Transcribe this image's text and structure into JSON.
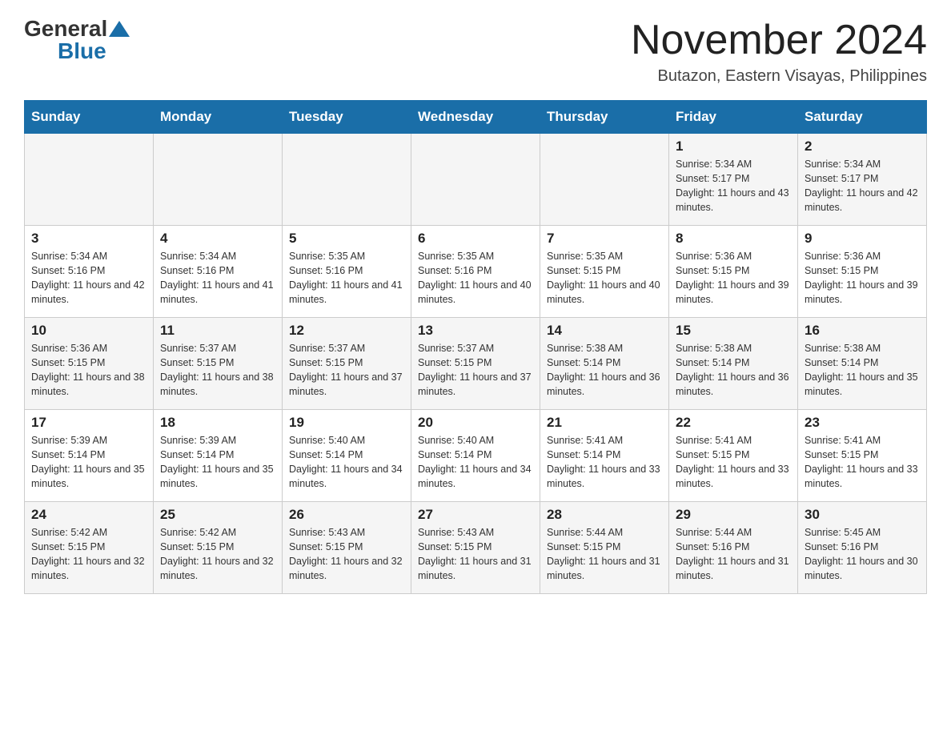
{
  "header": {
    "logo_general": "General",
    "logo_blue": "Blue",
    "month_title": "November 2024",
    "location": "Butazon, Eastern Visayas, Philippines"
  },
  "days_of_week": [
    "Sunday",
    "Monday",
    "Tuesday",
    "Wednesday",
    "Thursday",
    "Friday",
    "Saturday"
  ],
  "weeks": [
    [
      {
        "day": "",
        "info": ""
      },
      {
        "day": "",
        "info": ""
      },
      {
        "day": "",
        "info": ""
      },
      {
        "day": "",
        "info": ""
      },
      {
        "day": "",
        "info": ""
      },
      {
        "day": "1",
        "info": "Sunrise: 5:34 AM\nSunset: 5:17 PM\nDaylight: 11 hours and 43 minutes."
      },
      {
        "day": "2",
        "info": "Sunrise: 5:34 AM\nSunset: 5:17 PM\nDaylight: 11 hours and 42 minutes."
      }
    ],
    [
      {
        "day": "3",
        "info": "Sunrise: 5:34 AM\nSunset: 5:16 PM\nDaylight: 11 hours and 42 minutes."
      },
      {
        "day": "4",
        "info": "Sunrise: 5:34 AM\nSunset: 5:16 PM\nDaylight: 11 hours and 41 minutes."
      },
      {
        "day": "5",
        "info": "Sunrise: 5:35 AM\nSunset: 5:16 PM\nDaylight: 11 hours and 41 minutes."
      },
      {
        "day": "6",
        "info": "Sunrise: 5:35 AM\nSunset: 5:16 PM\nDaylight: 11 hours and 40 minutes."
      },
      {
        "day": "7",
        "info": "Sunrise: 5:35 AM\nSunset: 5:15 PM\nDaylight: 11 hours and 40 minutes."
      },
      {
        "day": "8",
        "info": "Sunrise: 5:36 AM\nSunset: 5:15 PM\nDaylight: 11 hours and 39 minutes."
      },
      {
        "day": "9",
        "info": "Sunrise: 5:36 AM\nSunset: 5:15 PM\nDaylight: 11 hours and 39 minutes."
      }
    ],
    [
      {
        "day": "10",
        "info": "Sunrise: 5:36 AM\nSunset: 5:15 PM\nDaylight: 11 hours and 38 minutes."
      },
      {
        "day": "11",
        "info": "Sunrise: 5:37 AM\nSunset: 5:15 PM\nDaylight: 11 hours and 38 minutes."
      },
      {
        "day": "12",
        "info": "Sunrise: 5:37 AM\nSunset: 5:15 PM\nDaylight: 11 hours and 37 minutes."
      },
      {
        "day": "13",
        "info": "Sunrise: 5:37 AM\nSunset: 5:15 PM\nDaylight: 11 hours and 37 minutes."
      },
      {
        "day": "14",
        "info": "Sunrise: 5:38 AM\nSunset: 5:14 PM\nDaylight: 11 hours and 36 minutes."
      },
      {
        "day": "15",
        "info": "Sunrise: 5:38 AM\nSunset: 5:14 PM\nDaylight: 11 hours and 36 minutes."
      },
      {
        "day": "16",
        "info": "Sunrise: 5:38 AM\nSunset: 5:14 PM\nDaylight: 11 hours and 35 minutes."
      }
    ],
    [
      {
        "day": "17",
        "info": "Sunrise: 5:39 AM\nSunset: 5:14 PM\nDaylight: 11 hours and 35 minutes."
      },
      {
        "day": "18",
        "info": "Sunrise: 5:39 AM\nSunset: 5:14 PM\nDaylight: 11 hours and 35 minutes."
      },
      {
        "day": "19",
        "info": "Sunrise: 5:40 AM\nSunset: 5:14 PM\nDaylight: 11 hours and 34 minutes."
      },
      {
        "day": "20",
        "info": "Sunrise: 5:40 AM\nSunset: 5:14 PM\nDaylight: 11 hours and 34 minutes."
      },
      {
        "day": "21",
        "info": "Sunrise: 5:41 AM\nSunset: 5:14 PM\nDaylight: 11 hours and 33 minutes."
      },
      {
        "day": "22",
        "info": "Sunrise: 5:41 AM\nSunset: 5:15 PM\nDaylight: 11 hours and 33 minutes."
      },
      {
        "day": "23",
        "info": "Sunrise: 5:41 AM\nSunset: 5:15 PM\nDaylight: 11 hours and 33 minutes."
      }
    ],
    [
      {
        "day": "24",
        "info": "Sunrise: 5:42 AM\nSunset: 5:15 PM\nDaylight: 11 hours and 32 minutes."
      },
      {
        "day": "25",
        "info": "Sunrise: 5:42 AM\nSunset: 5:15 PM\nDaylight: 11 hours and 32 minutes."
      },
      {
        "day": "26",
        "info": "Sunrise: 5:43 AM\nSunset: 5:15 PM\nDaylight: 11 hours and 32 minutes."
      },
      {
        "day": "27",
        "info": "Sunrise: 5:43 AM\nSunset: 5:15 PM\nDaylight: 11 hours and 31 minutes."
      },
      {
        "day": "28",
        "info": "Sunrise: 5:44 AM\nSunset: 5:15 PM\nDaylight: 11 hours and 31 minutes."
      },
      {
        "day": "29",
        "info": "Sunrise: 5:44 AM\nSunset: 5:16 PM\nDaylight: 11 hours and 31 minutes."
      },
      {
        "day": "30",
        "info": "Sunrise: 5:45 AM\nSunset: 5:16 PM\nDaylight: 11 hours and 30 minutes."
      }
    ]
  ]
}
